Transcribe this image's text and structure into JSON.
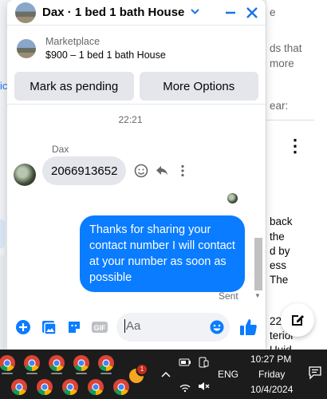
{
  "chat": {
    "title": "Dax · 1 bed 1 bath House",
    "listing_source": "Marketplace",
    "listing_summary": "$900 – 1 bed 1 bath House",
    "mark_pending_label": "Mark as pending",
    "more_options_label": "More Options",
    "timestamp": "22:21",
    "sender_name": "Dax",
    "incoming_message": "2066913652",
    "outgoing_message": "Thanks for sharing your contact number I will contact at your number as soon as possible",
    "sent_status": "Sent",
    "composer_placeholder": "Aa",
    "accent_color": "#0a7cff"
  },
  "background": {
    "right_lines": [
      "e",
      "ds that",
      "more",
      "ear:",
      "back",
      "the",
      "d by",
      "ess",
      "The",
      "22",
      "terior",
      "Uuid"
    ]
  },
  "taskbar": {
    "time": "10:27 PM",
    "day": "Friday",
    "date": "10/4/2024",
    "language": "ENG",
    "notification_count": "1",
    "apps": [
      "chrome-icon",
      "chrome-icon",
      "chrome-icon",
      "chrome-icon",
      "chrome-icon",
      "chrome-icon",
      "chrome-icon",
      "chrome-icon",
      "chrome-icon",
      "chrome-icon"
    ]
  }
}
